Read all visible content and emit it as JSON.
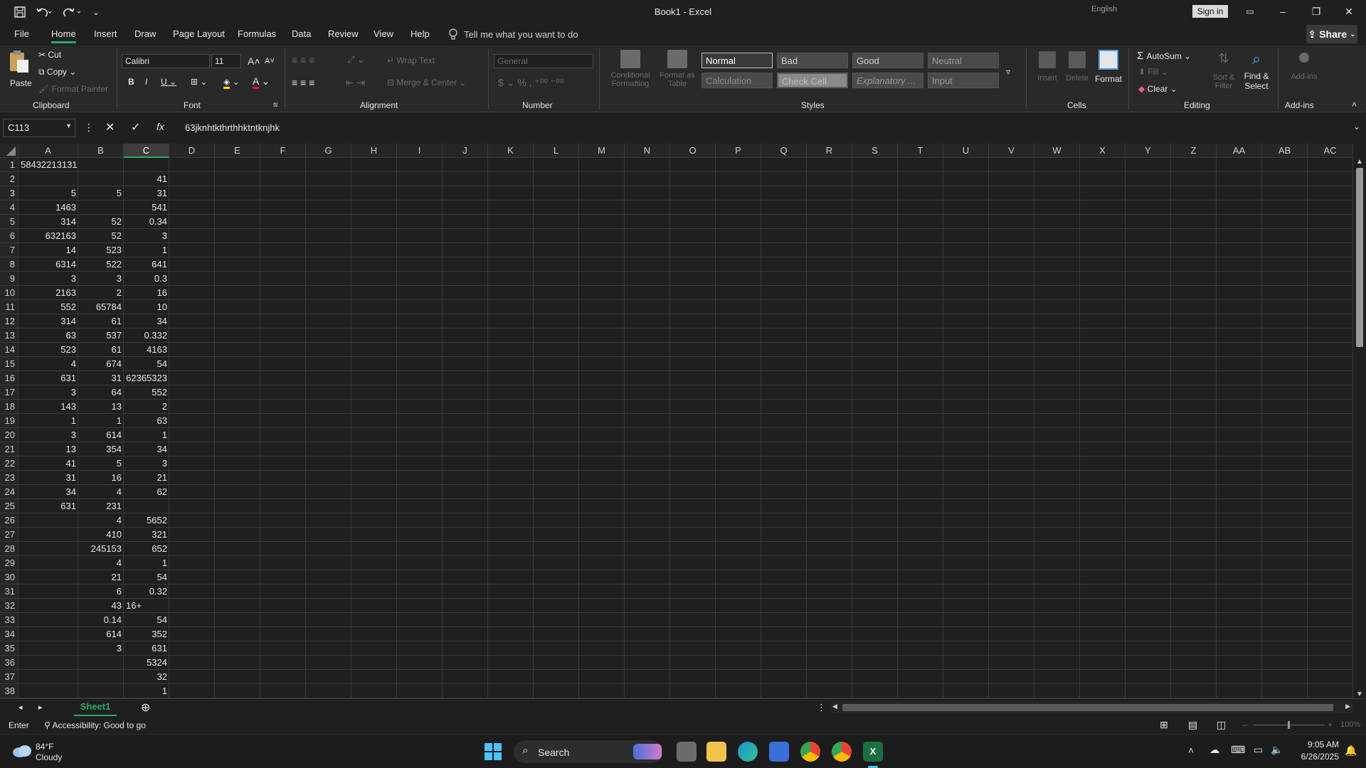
{
  "title": "Book1  -  Excel",
  "titlebar": {
    "language": "English",
    "signin_label": "Sign in"
  },
  "tabs": [
    "File",
    "Home",
    "Insert",
    "Draw",
    "Page Layout",
    "Formulas",
    "Data",
    "Review",
    "View",
    "Help"
  ],
  "tellme": "Tell me what you want to do",
  "share_label": "Share",
  "ribbon": {
    "clipboard": {
      "paste": "Paste",
      "cut": "Cut",
      "copy": "Copy",
      "format_painter": "Format Painter",
      "label": "Clipboard"
    },
    "font": {
      "name": "Calibri",
      "size": "11",
      "label": "Font"
    },
    "alignment": {
      "wrap_text": "Wrap Text",
      "merge_center": "Merge & Center",
      "label": "Alignment"
    },
    "number": {
      "format": "General",
      "label": "Number"
    },
    "styles": {
      "conditional": "Conditional Formatting",
      "format_as_table": "Format as Table",
      "cells": [
        "Normal",
        "Bad",
        "Good",
        "Neutral",
        "Calculation",
        "Check Cell",
        "Explanatory ...",
        "Input"
      ],
      "label": "Styles"
    },
    "cells": {
      "insert": "Insert",
      "delete": "Delete",
      "format": "Format",
      "label": "Cells"
    },
    "editing": {
      "autosum": "AutoSum",
      "fill": "Fill",
      "clear": "Clear",
      "sort_filter": "Sort & Filter",
      "find_select": "Find & Select",
      "label": "Editing"
    },
    "addins": {
      "addins": "Add-ins",
      "label": "Add-ins"
    }
  },
  "formula_bar": {
    "name_box": "C113",
    "content": "63jknhtkthrthhktntknjhk"
  },
  "columns": [
    "A",
    "B",
    "C",
    "D",
    "E",
    "F",
    "G",
    "H",
    "I",
    "J",
    "K",
    "L",
    "M",
    "N",
    "O",
    "P",
    "Q",
    "R",
    "S",
    "T",
    "U",
    "V",
    "W",
    "X",
    "Y",
    "Z",
    "AA",
    "AB",
    "AC"
  ],
  "rows": [
    [
      "58432213131",
      "",
      ""
    ],
    [
      "",
      "",
      "41"
    ],
    [
      "5",
      "5",
      "31"
    ],
    [
      "1463",
      "",
      "541"
    ],
    [
      "314",
      "52",
      "0.34"
    ],
    [
      "632163",
      "52",
      "3"
    ],
    [
      "14",
      "523",
      "1"
    ],
    [
      "6314",
      "522",
      "641"
    ],
    [
      "3",
      "3",
      "0.3"
    ],
    [
      "2163",
      "2",
      "16"
    ],
    [
      "552",
      "65784",
      "10"
    ],
    [
      "314",
      "61",
      "34"
    ],
    [
      "63",
      "537",
      "0.332"
    ],
    [
      "523",
      "61",
      "4163"
    ],
    [
      "4",
      "674",
      "54"
    ],
    [
      "631",
      "31",
      "62365323"
    ],
    [
      "3",
      "64",
      "552"
    ],
    [
      "143",
      "13",
      "2"
    ],
    [
      "1",
      "1",
      "63"
    ],
    [
      "3",
      "614",
      "1"
    ],
    [
      "13",
      "354",
      "34"
    ],
    [
      "41",
      "5",
      "3"
    ],
    [
      "31",
      "16",
      "21"
    ],
    [
      "34",
      "4",
      "62"
    ],
    [
      "631",
      "231",
      ""
    ],
    [
      "",
      "4",
      "5652"
    ],
    [
      "",
      "410",
      "321"
    ],
    [
      "",
      "245153",
      "652"
    ],
    [
      "",
      "4",
      "1"
    ],
    [
      "",
      "21",
      "54"
    ],
    [
      "",
      "6",
      "0.32"
    ],
    [
      "",
      "43",
      "16+"
    ],
    [
      "",
      "0.14",
      "54"
    ],
    [
      "",
      "614",
      "352"
    ],
    [
      "",
      "3",
      "631"
    ],
    [
      "",
      "",
      "5324"
    ],
    [
      "",
      "",
      "32"
    ],
    [
      "",
      "",
      "1"
    ]
  ],
  "sheet_tab": "Sheet1",
  "status": {
    "mode": "Enter",
    "accessibility": "Accessibility: Good to go",
    "zoom": "100%"
  },
  "taskbar": {
    "weather_temp": "84°F",
    "weather_desc": "Cloudy",
    "search": "Search",
    "time": "9:05 AM",
    "date": "6/26/2025"
  },
  "colors": {
    "accent": "#2fa866",
    "bg": "#1f1f1f",
    "ribbon": "#292929"
  }
}
